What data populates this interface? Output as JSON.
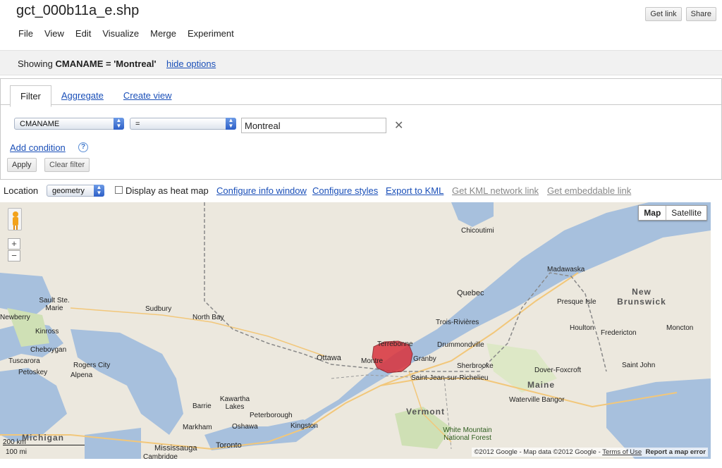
{
  "header": {
    "title": "gct_000b11a_e.shp",
    "get_link": "Get link",
    "share": "Share",
    "menu": [
      "File",
      "View",
      "Edit",
      "Visualize",
      "Merge",
      "Experiment"
    ]
  },
  "infobar": {
    "showing_prefix": "Showing",
    "condition": "CMANAME = 'Montreal'",
    "hide_options": "hide options"
  },
  "filter_panel": {
    "tabs": [
      "Filter",
      "Aggregate",
      "Create view"
    ],
    "column_select": "CMANAME",
    "operator_select": "=",
    "value_input": "Montreal",
    "add_condition": "Add condition",
    "help": "?",
    "apply": "Apply",
    "clear_filter": "Clear filter"
  },
  "location_bar": {
    "location_label": "Location",
    "location_select": "geometry",
    "heatmap_label": "Display as heat map",
    "configure_info_window": "Configure info window",
    "configure_styles": "Configure styles",
    "export_kml": "Export to KML",
    "get_kml_network": "Get KML network link",
    "get_embeddable": "Get embeddable link"
  },
  "map": {
    "map_type": [
      "Map",
      "Satellite"
    ],
    "scale_km": "200 km",
    "scale_mi": "100 mi",
    "attribution": "©2012 Google - Map data ©2012 Google -",
    "terms": "Terms of Use",
    "report": "Report a map error",
    "cities": [
      "Chicoutimi",
      "Madawaska",
      "Quebec",
      "Presque Isle",
      "Trois-Rivières",
      "Houlton",
      "Fredericton",
      "Moncton",
      "Drummondville",
      "Ottawa",
      "Montre",
      "Terrebonne",
      "Granby",
      "Sherbrooke",
      "Saint-Jean-sur-Richelieu",
      "Saint John",
      "Dover-Foxcroft",
      "Waterville Bangor",
      "Sault Ste. Marie",
      "Sudbury",
      "North Bay",
      "Newberry",
      "Kinross",
      "Cheboygan",
      "Tuscarora",
      "Petoskey",
      "Rogers City",
      "Alpena",
      "Barrie",
      "Kawartha Lakes",
      "Peterborough",
      "Kingston",
      "Markham",
      "Oshawa",
      "Mississauga",
      "Toronto",
      "Cambridge"
    ],
    "regions": [
      "New Brunswick",
      "Maine",
      "Vermont",
      "Michigan"
    ],
    "features": [
      "White Mountain National Forest"
    ],
    "highlight_color": "#d9323c"
  }
}
